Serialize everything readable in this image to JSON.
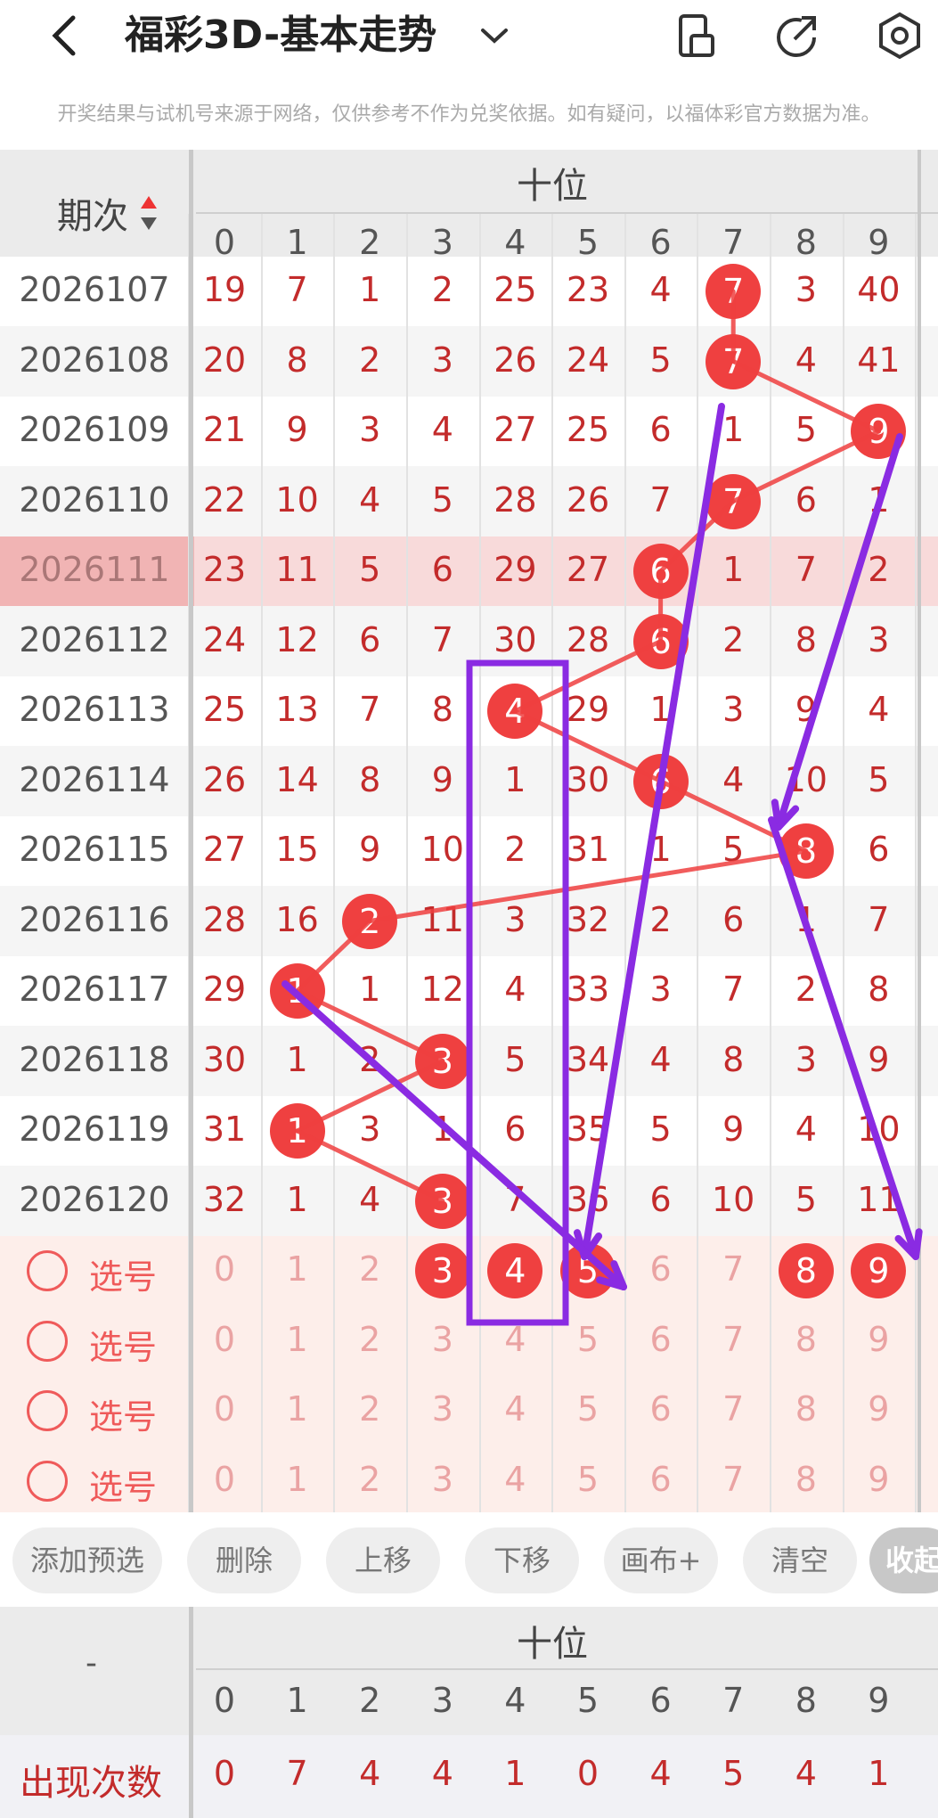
{
  "header": {
    "title": "福彩3D-基本走势",
    "disclaimer": "开奖结果与试机号来源于网络，仅供参考不作为兑奖依据。如有疑问，以福体彩官方数据为准。"
  },
  "table": {
    "period_header": "期次",
    "group_header": "十位",
    "digits": [
      "0",
      "1",
      "2",
      "3",
      "4",
      "5",
      "6",
      "7",
      "8",
      "9"
    ],
    "rows": [
      {
        "period": "2026107",
        "cells": [
          "19",
          "7",
          "1",
          "2",
          "25",
          "23",
          "4",
          "7",
          "3",
          "40"
        ],
        "hit": 7
      },
      {
        "period": "2026108",
        "cells": [
          "20",
          "8",
          "2",
          "3",
          "26",
          "24",
          "5",
          "7",
          "4",
          "41"
        ],
        "hit": 7
      },
      {
        "period": "2026109",
        "cells": [
          "21",
          "9",
          "3",
          "4",
          "27",
          "25",
          "6",
          "1",
          "5",
          "9"
        ],
        "hit": 9
      },
      {
        "period": "2026110",
        "cells": [
          "22",
          "10",
          "4",
          "5",
          "28",
          "26",
          "7",
          "7",
          "6",
          "1"
        ],
        "hit": 7
      },
      {
        "period": "2026111",
        "cells": [
          "23",
          "11",
          "5",
          "6",
          "29",
          "27",
          "6",
          "1",
          "7",
          "2"
        ],
        "hit": 6,
        "highlight": true
      },
      {
        "period": "2026112",
        "cells": [
          "24",
          "12",
          "6",
          "7",
          "30",
          "28",
          "6",
          "2",
          "8",
          "3"
        ],
        "hit": 6
      },
      {
        "period": "2026113",
        "cells": [
          "25",
          "13",
          "7",
          "8",
          "4",
          "29",
          "1",
          "3",
          "9",
          "4"
        ],
        "hit": 4
      },
      {
        "period": "2026114",
        "cells": [
          "26",
          "14",
          "8",
          "9",
          "1",
          "30",
          "6",
          "4",
          "10",
          "5"
        ],
        "hit": 6
      },
      {
        "period": "2026115",
        "cells": [
          "27",
          "15",
          "9",
          "10",
          "2",
          "31",
          "1",
          "5",
          "8",
          "6"
        ],
        "hit": 8
      },
      {
        "period": "2026116",
        "cells": [
          "28",
          "16",
          "2",
          "11",
          "3",
          "32",
          "2",
          "6",
          "1",
          "7"
        ],
        "hit": 2
      },
      {
        "period": "2026117",
        "cells": [
          "29",
          "1",
          "1",
          "12",
          "4",
          "33",
          "3",
          "7",
          "2",
          "8"
        ],
        "hit": 1
      },
      {
        "period": "2026118",
        "cells": [
          "30",
          "1",
          "2",
          "3",
          "5",
          "34",
          "4",
          "8",
          "3",
          "9"
        ],
        "hit": 3
      },
      {
        "period": "2026119",
        "cells": [
          "31",
          "1",
          "3",
          "1",
          "6",
          "35",
          "5",
          "9",
          "4",
          "10"
        ],
        "hit": 1
      },
      {
        "period": "2026120",
        "cells": [
          "32",
          "1",
          "4",
          "3",
          "7",
          "36",
          "6",
          "10",
          "5",
          "11"
        ],
        "hit": 3
      }
    ],
    "pick_label": "选号",
    "pick_rows": [
      {
        "selected": [
          "3",
          "4",
          "5",
          "8",
          "9"
        ]
      },
      {
        "selected": []
      },
      {
        "selected": []
      },
      {
        "selected": []
      }
    ]
  },
  "buttons": [
    "添加预选",
    "删除",
    "上移",
    "下移",
    "画布+",
    "清空",
    "收起"
  ],
  "stats": {
    "corner": "-",
    "group_header": "十位",
    "label": "出现次数",
    "values": [
      "0",
      "7",
      "4",
      "4",
      "1",
      "0",
      "4",
      "5",
      "4",
      "1"
    ]
  },
  "colors": {
    "ball": "#ef4040",
    "text_red": "#c32b2b",
    "annotation": "#8a2be2",
    "pick_bg": "#fdeeea",
    "highlight": "#f8dada"
  }
}
